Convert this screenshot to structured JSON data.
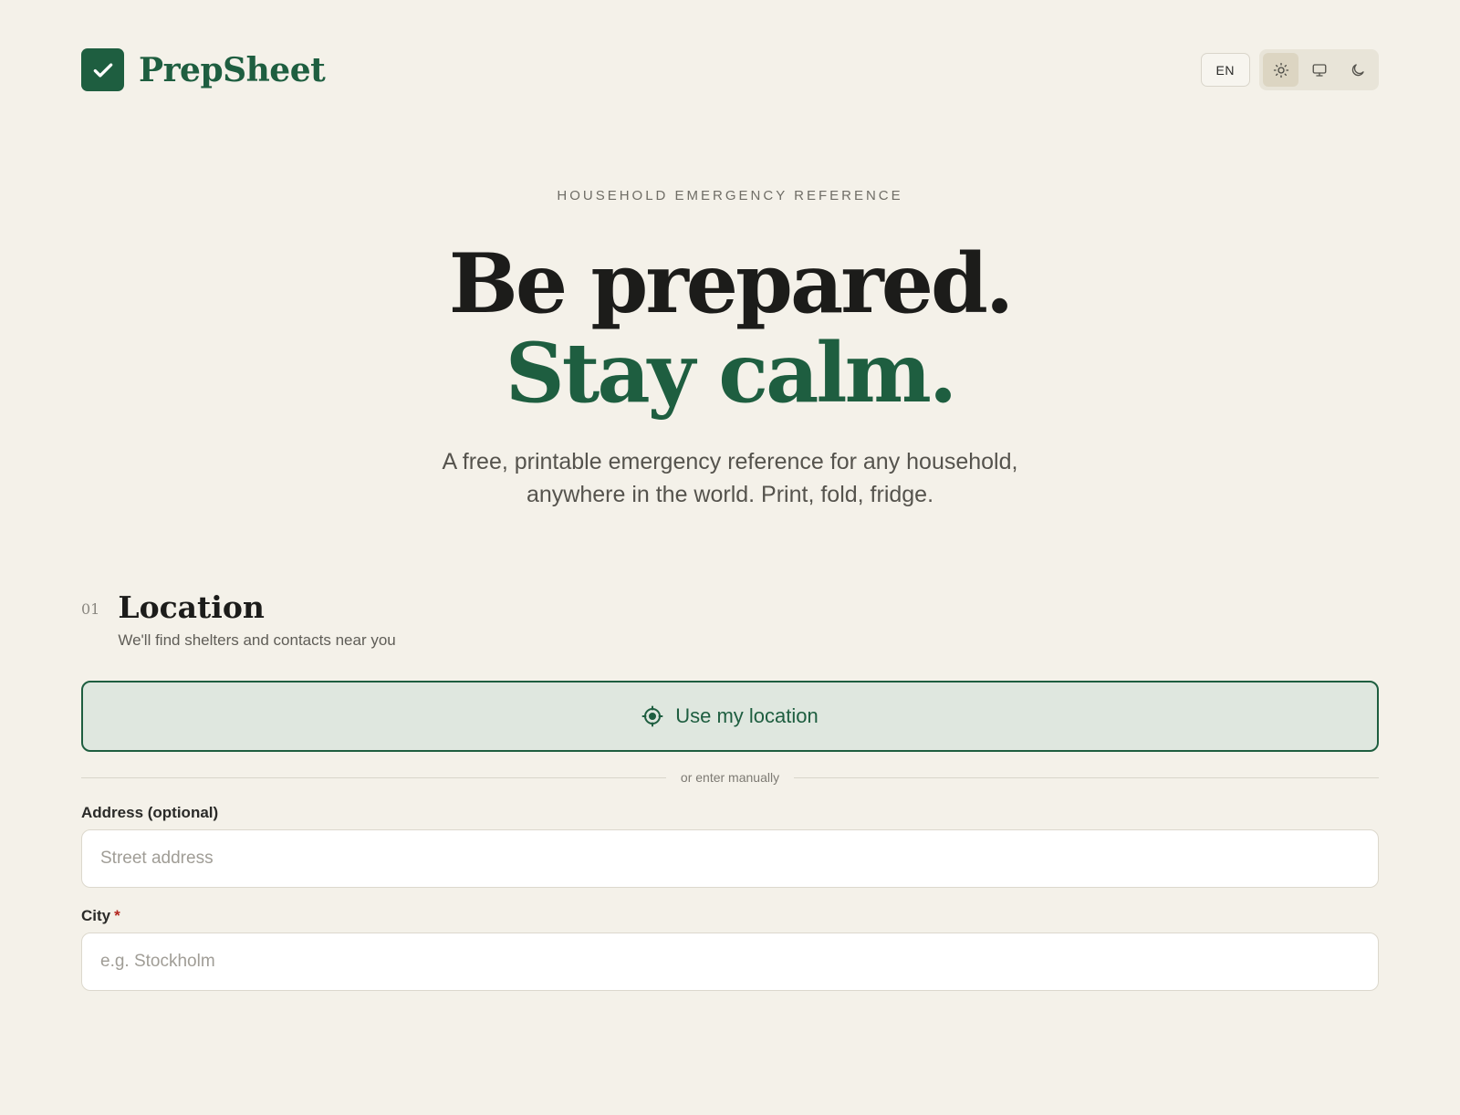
{
  "brand": {
    "name": "PrepSheet",
    "accent_color": "#1e5e40",
    "logo_icon": "checkmark-icon"
  },
  "header": {
    "language": "EN",
    "theme_options": [
      {
        "name": "light",
        "icon": "sun-icon",
        "active": true
      },
      {
        "name": "system",
        "icon": "monitor-icon",
        "active": false
      },
      {
        "name": "dark",
        "icon": "moon-icon",
        "active": false
      }
    ]
  },
  "hero": {
    "eyebrow": "HOUSEHOLD EMERGENCY REFERENCE",
    "headline_line1": "Be prepared.",
    "headline_line2": "Stay calm.",
    "subline_line1": "A free, printable emergency reference for any household,",
    "subline_line2": "anywhere in the world. Print, fold, fridge."
  },
  "location_section": {
    "number": "01",
    "title": "Location",
    "subtitle": "We'll find shelters and contacts near you",
    "use_location_label": "Use my location",
    "use_location_icon": "crosshair-icon",
    "divider_text": "or enter manually",
    "address": {
      "label": "Address (optional)",
      "placeholder": "Street address",
      "value": ""
    },
    "city": {
      "label": "City",
      "required_marker": "*",
      "placeholder": "e.g. Stockholm",
      "value": ""
    }
  }
}
